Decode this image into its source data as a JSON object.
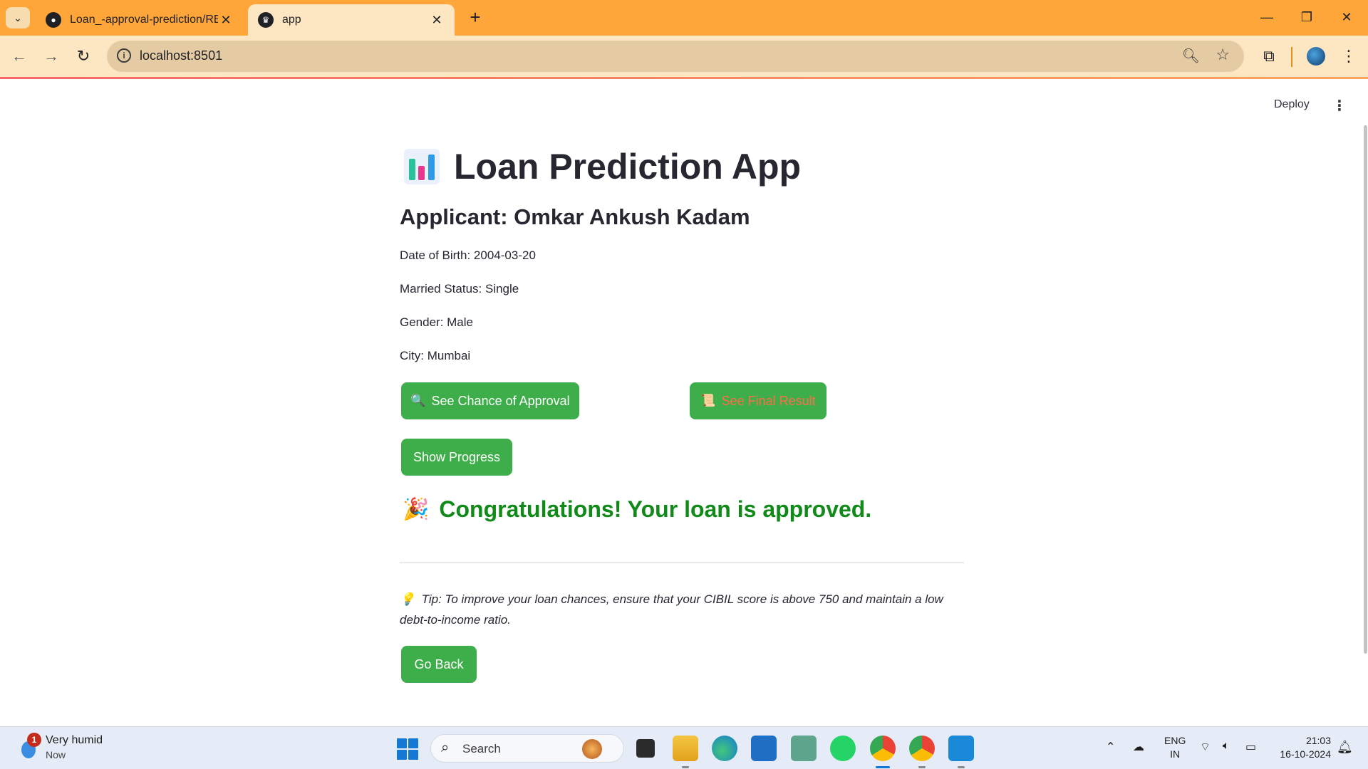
{
  "browser": {
    "tabs": [
      {
        "title": "Loan_-approval-prediction/REA",
        "favicon": "github-icon",
        "active": false
      },
      {
        "title": "app",
        "favicon": "streamlit-icon",
        "active": true
      }
    ],
    "url": "localhost:8501",
    "chrome_color": "#fea63a"
  },
  "app": {
    "deploy_label": "Deploy",
    "title": "Loan Prediction App",
    "title_emoji": "bar-chart-icon",
    "applicant_heading": "Applicant: Omkar Ankush Kadam",
    "details": {
      "dob": "Date of Birth: 2004-03-20",
      "married": "Married Status: Single",
      "gender": "Gender: Male",
      "city": "City: Mumbai"
    },
    "buttons": {
      "chance": {
        "emoji": "🔍",
        "label": "See Chance of Approval"
      },
      "final": {
        "emoji": "📜",
        "label": "See Final Result"
      },
      "progress": {
        "label": "Show Progress"
      },
      "back": {
        "label": "Go Back"
      }
    },
    "result": {
      "emoji": "🎉",
      "message": "Congratulations! Your loan is approved."
    },
    "tip": {
      "emoji": "💡",
      "text": "Tip: To improve your loan chances, ensure that your CIBIL score is above 750 and maintain a low debt-to-income ratio."
    },
    "colors": {
      "button": "#3dae49",
      "success_text": "#128a1a",
      "final_label": "#ff6d4a"
    }
  },
  "taskbar": {
    "weather": {
      "title": "Very humid",
      "subtitle": "Now",
      "badge": "1"
    },
    "search_label": "Search",
    "language": {
      "line1": "ENG",
      "line2": "IN"
    },
    "clock": {
      "time": "21:03",
      "date": "16-10-2024"
    }
  }
}
